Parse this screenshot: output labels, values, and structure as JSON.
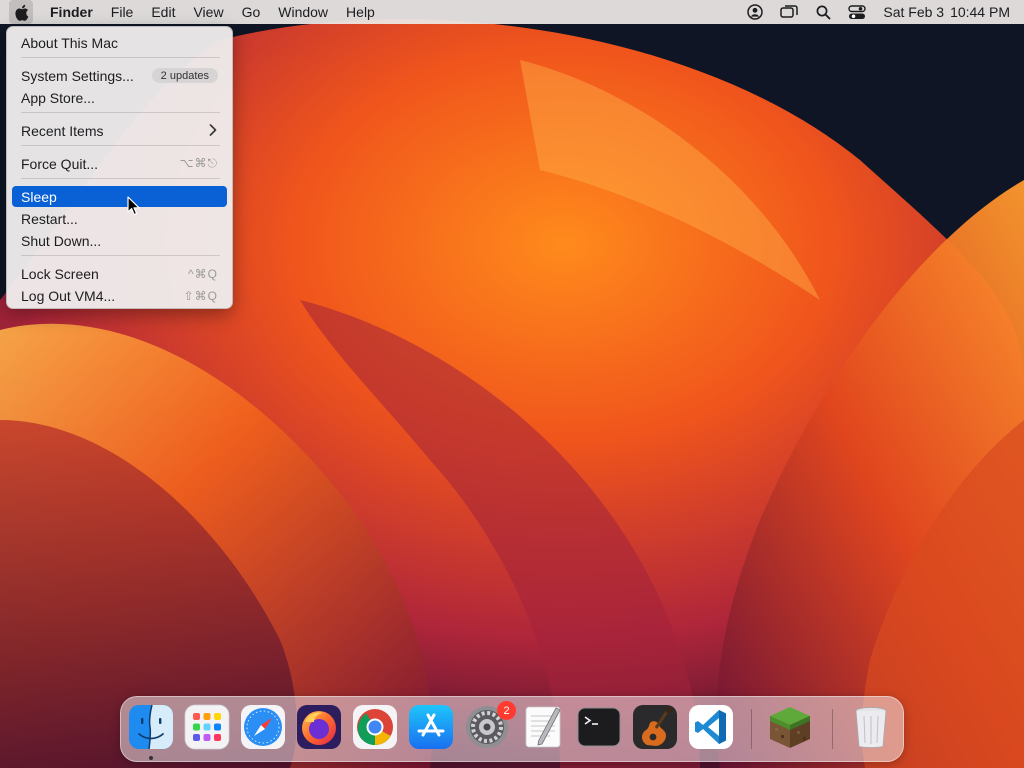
{
  "menubar": {
    "app_name": "Finder",
    "menus": [
      "File",
      "Edit",
      "View",
      "Go",
      "Window",
      "Help"
    ],
    "status_icons": [
      "user-account-icon",
      "screen-mirroring-icon",
      "spotlight-search-icon",
      "control-center-icon"
    ],
    "date": "Sat Feb 3",
    "time": "10:44 PM"
  },
  "apple_menu": {
    "about": "About This Mac",
    "system_settings": "System Settings...",
    "updates_badge": "2 updates",
    "app_store": "App Store...",
    "recent_items": "Recent Items",
    "force_quit": "Force Quit...",
    "force_quit_shortcut": "⌥⌘⎋",
    "sleep": "Sleep",
    "restart": "Restart...",
    "shut_down": "Shut Down...",
    "lock_screen": "Lock Screen",
    "lock_screen_shortcut": "^⌘Q",
    "log_out": "Log Out VM4...",
    "log_out_shortcut": "⇧⌘Q",
    "selected_item": "Sleep"
  },
  "dock": {
    "apps": [
      "Finder",
      "Launchpad",
      "Safari",
      "Firefox",
      "Google Chrome",
      "App Store",
      "System Settings",
      "TextEdit",
      "Terminal",
      "GarageBand",
      "Visual Studio Code",
      "Minecraft",
      "Trash"
    ],
    "system_settings_badge": "2",
    "running": [
      "Finder"
    ]
  },
  "colors": {
    "selection": "#0a61d5",
    "badge_red": "#ff3b30"
  }
}
